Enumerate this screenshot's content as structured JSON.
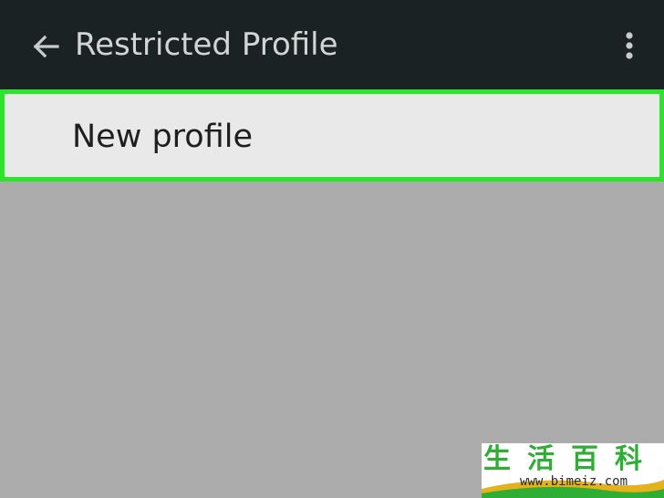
{
  "app_bar": {
    "back_icon": "arrow-back-icon",
    "title": "Restricted Profile",
    "overflow_icon": "more-vert-icon",
    "background": "#1b2224",
    "title_color": "#d3d5d5"
  },
  "profiles": {
    "items": [
      {
        "label": "New profile"
      }
    ],
    "highlight_color": "#2ee32c"
  },
  "watermark": {
    "logo_text": "生活百科",
    "url": "www.bimeiz.com"
  }
}
